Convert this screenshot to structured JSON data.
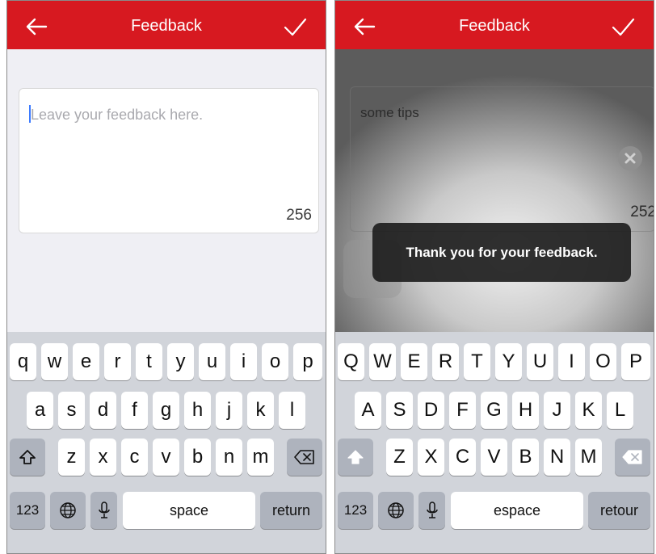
{
  "left_screen": {
    "nav": {
      "title": "Feedback",
      "back_icon": "arrow-left-icon",
      "confirm_icon": "check-icon",
      "color": "#d71920"
    },
    "textbox": {
      "placeholder": "Leave your feedback here.",
      "counter": "256"
    },
    "keyboard": {
      "row1": [
        "q",
        "w",
        "e",
        "r",
        "t",
        "y",
        "u",
        "i",
        "o",
        "p"
      ],
      "row2": [
        "a",
        "s",
        "d",
        "f",
        "g",
        "h",
        "j",
        "k",
        "l"
      ],
      "row3": [
        "z",
        "x",
        "c",
        "v",
        "b",
        "n",
        "m"
      ],
      "numbers": "123",
      "space": "space",
      "return": "return",
      "icons": {
        "shift": "shift-icon",
        "delete": "delete-icon",
        "globe": "globe-icon",
        "mic": "microphone-icon"
      }
    }
  },
  "right_screen": {
    "nav": {
      "title": "Feedback",
      "back_icon": "arrow-left-icon",
      "confirm_icon": "check-icon",
      "color": "#d71920"
    },
    "textbox": {
      "value": "some tips",
      "counter": "252"
    },
    "toast": {
      "message": "Thank you for your feedback."
    },
    "keyboard": {
      "row1": [
        "Q",
        "W",
        "E",
        "R",
        "T",
        "Y",
        "U",
        "I",
        "O",
        "P"
      ],
      "row2": [
        "A",
        "S",
        "D",
        "F",
        "G",
        "H",
        "J",
        "K",
        "L"
      ],
      "row3": [
        "Z",
        "X",
        "C",
        "V",
        "B",
        "N",
        "M"
      ],
      "numbers": "123",
      "space": "espace",
      "return": "retour",
      "icons": {
        "shift": "shift-icon",
        "delete": "delete-icon",
        "globe": "globe-icon",
        "mic": "microphone-icon",
        "clear": "clear-icon"
      }
    }
  }
}
